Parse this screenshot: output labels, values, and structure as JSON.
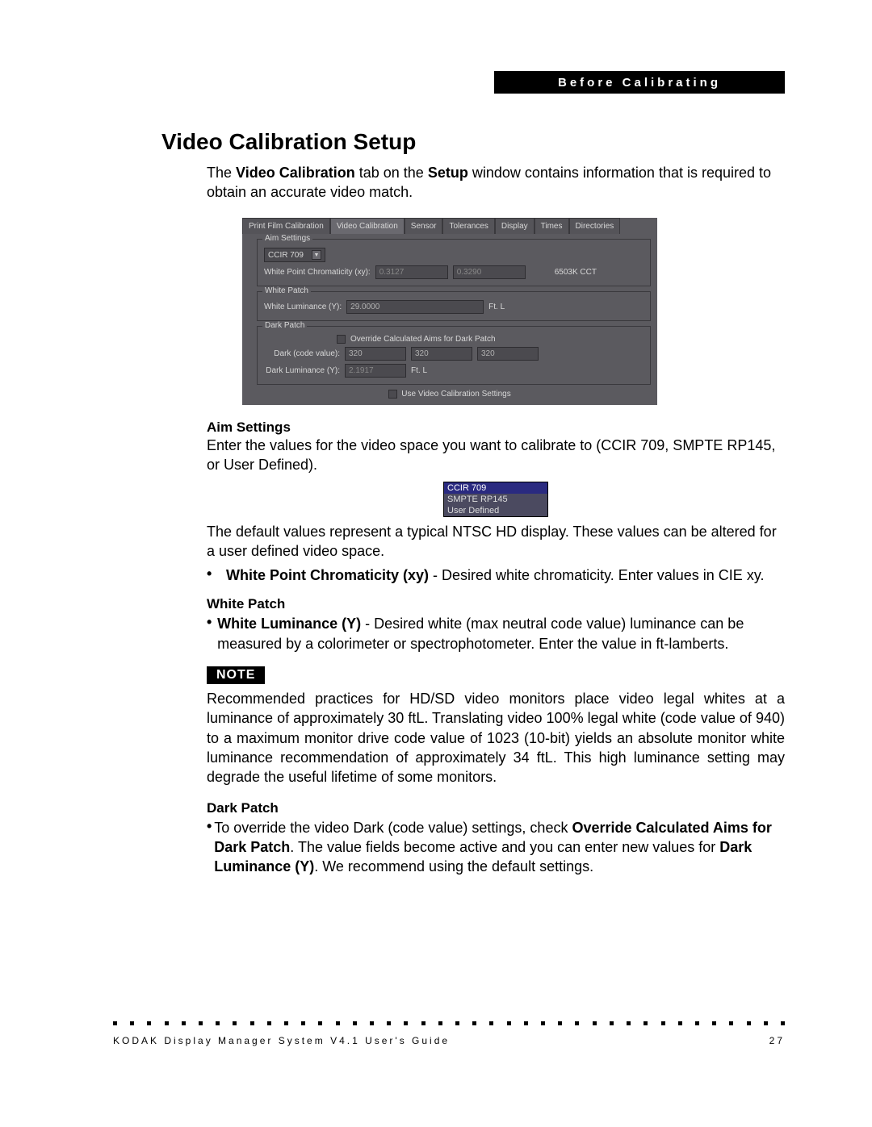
{
  "header": "Before Calibrating",
  "title": "Video Calibration Setup",
  "intro_pre": "The ",
  "intro_b1": "Video Calibration",
  "intro_mid": " tab on the ",
  "intro_b2": "Setup",
  "intro_post": " window contains information that is required to obtain an accurate video match.",
  "panel": {
    "tabs": [
      "Print Film Calibration",
      "Video Calibration",
      "Sensor",
      "Tolerances",
      "Display",
      "Times",
      "Directories"
    ],
    "aim": {
      "legend": "Aim Settings",
      "select_value": "CCIR 709",
      "wp_label": "White Point Chromaticity (xy):",
      "wp_x": "0.3127",
      "wp_y": "0.3290",
      "cct": "6503K CCT"
    },
    "white": {
      "legend": "White Patch",
      "lum_label": "White Luminance (Y):",
      "lum_value": "29.0000",
      "unit": "Ft. L"
    },
    "dark": {
      "legend": "Dark Patch",
      "override_label": "Override Calculated Aims for Dark Patch",
      "code_label": "Dark (code value):",
      "code1": "320",
      "code2": "320",
      "code3": "320",
      "lum_label": "Dark Luminance (Y):",
      "lum_value": "2.1917",
      "unit": "Ft. L"
    },
    "use_settings": "Use Video Calibration Settings"
  },
  "aim_h": "Aim Settings",
  "aim_p1": "Enter the values for the video space you want to calibrate to (CCIR 709, SMPTE RP145, or User Defined).",
  "aim_dd": {
    "opt1": "CCIR 709",
    "opt2": "SMPTE RP145",
    "opt3": "User Defined"
  },
  "aim_p2": "The default values represent a typical NTSC HD display. These values can be altered for a user defined video space.",
  "aim_b1_strong": "White Point Chromaticity (xy)",
  "aim_b1_rest": " - Desired white chromaticity. Enter values in CIE xy.",
  "white_h": "White Patch",
  "white_b1_strong": "White Luminance (Y)",
  "white_b1_rest": " - Desired white (max neutral code value) luminance can be measured by a colorimeter or spectrophotometer. Enter the value in ft-lamberts.",
  "note_label": "NOTE",
  "note_p": "Recommended practices for HD/SD video monitors place video legal whites at a luminance of approximately 30 ftL. Translating video 100% legal white (code value of 940) to a maximum monitor drive code value of 1023 (10-bit) yields an absolute monitor white luminance recommendation of approximately 34 ftL. This high luminance setting may degrade the useful lifetime of some monitors.",
  "dark_h": "Dark Patch",
  "dark_b1_pre": "To override the video Dark (code value) settings, check ",
  "dark_b1_strong": "Override Calculated Aims for Dark Patch",
  "dark_b1_mid": ". The value fields become active and you can enter new values for ",
  "dark_b1_strong2": "Dark Luminance (Y)",
  "dark_b1_post": ". We recommend using the default settings.",
  "footer_left": "KODAK Display Manager System V4.1 User's Guide",
  "footer_right": "27"
}
